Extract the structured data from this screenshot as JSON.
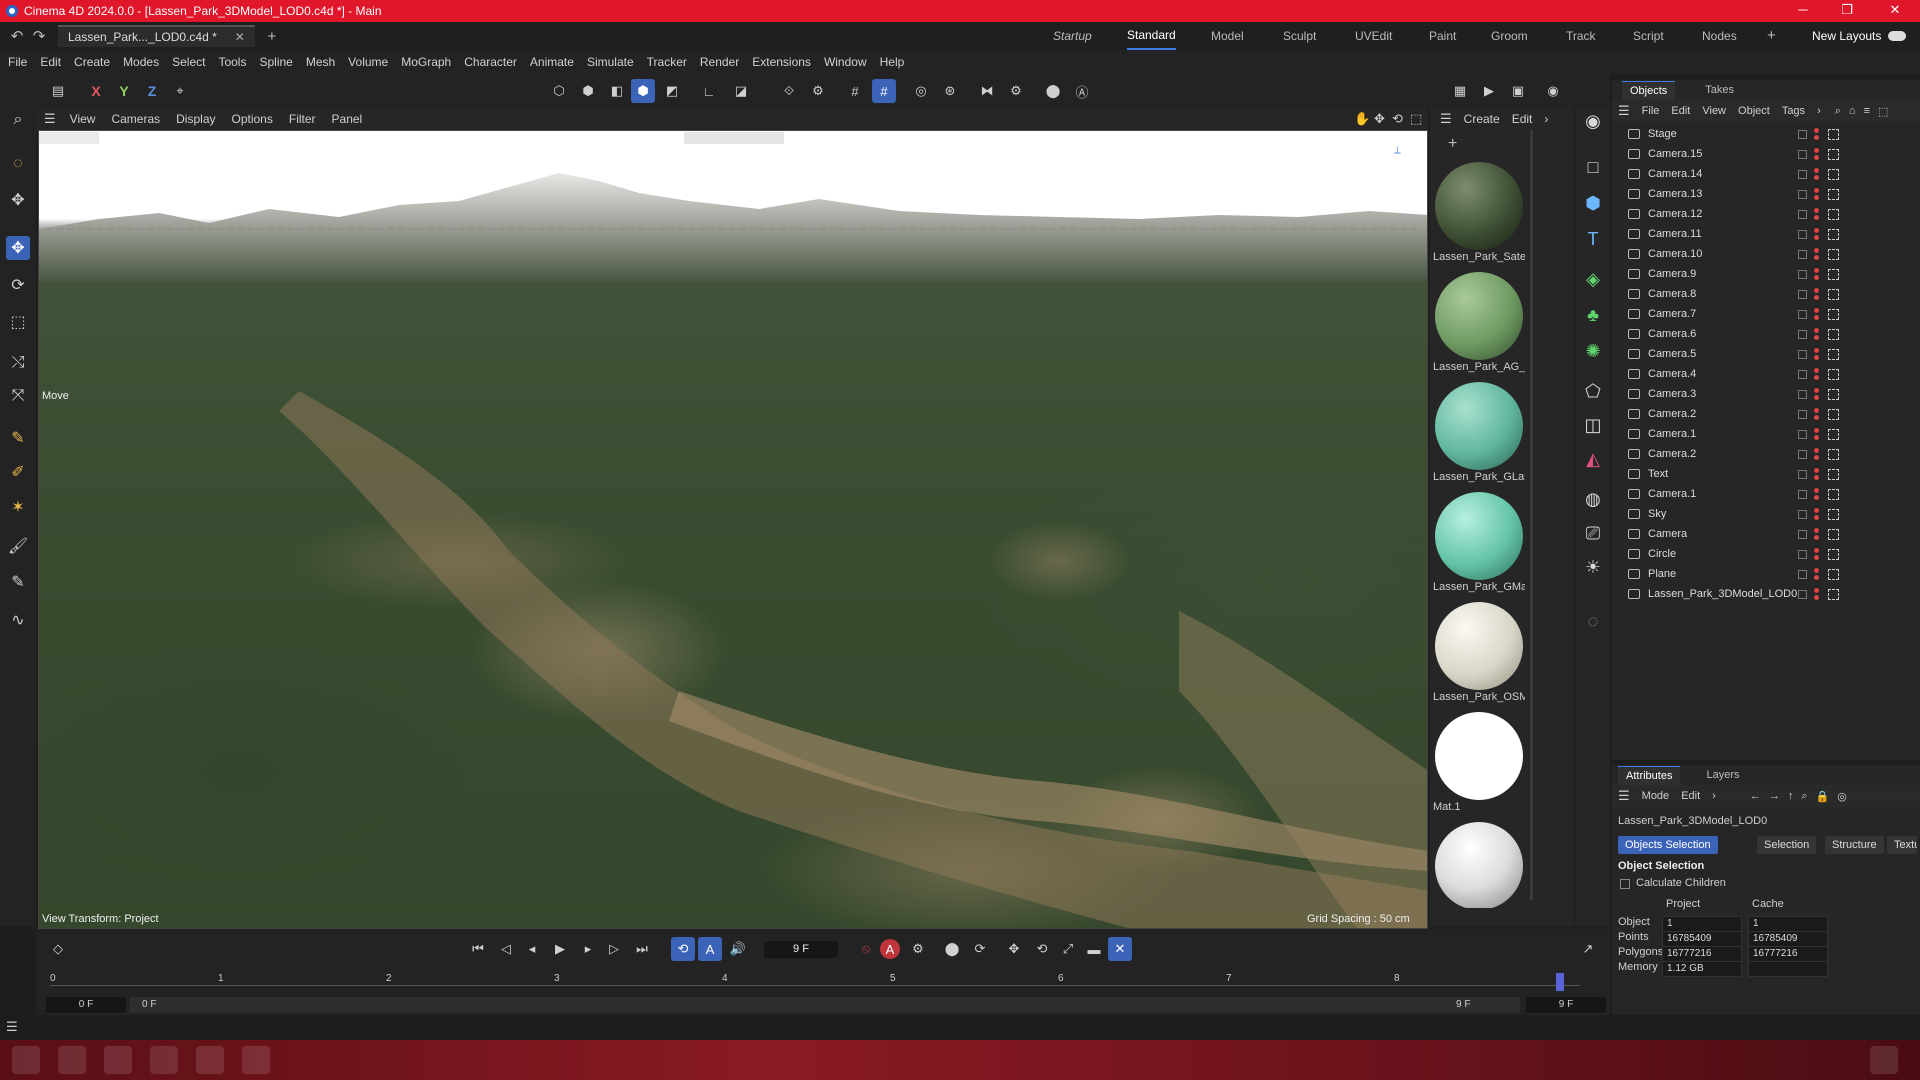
{
  "app_title": "Cinema 4D 2024.0.0 - [Lassen_Park_3DModel_LOD0.c4d *] - Main",
  "doc_tab": "Lassen_Park..._LOD0.c4d *",
  "layouts": [
    "Startup",
    "Standard",
    "Model",
    "Sculpt",
    "UVEdit",
    "Paint",
    "Groom",
    "Track",
    "Script",
    "Nodes"
  ],
  "active_layout": "Standard",
  "new_layouts": "New Layouts",
  "menubar": [
    "File",
    "Edit",
    "Create",
    "Modes",
    "Select",
    "Tools",
    "Spline",
    "Mesh",
    "Volume",
    "MoGraph",
    "Character",
    "Animate",
    "Simulate",
    "Tracker",
    "Render",
    "Extensions",
    "Window",
    "Help"
  ],
  "axis": {
    "x": "X",
    "y": "Y",
    "z": "Z"
  },
  "viewport": {
    "menu": [
      "View",
      "Cameras",
      "Display",
      "Options",
      "Filter",
      "Panel"
    ],
    "move_label": "Move",
    "view_transform": "View Transform: Project",
    "grid_spacing": "Grid Spacing : 50 cm"
  },
  "materials": {
    "menu": [
      "Create",
      "Edit"
    ],
    "items": [
      {
        "name": "Lassen_Park_Satel",
        "color": "#3a4a30"
      },
      {
        "name": "Lassen_Park_AG_L",
        "color": "#6f9a62"
      },
      {
        "name": "Lassen_Park_GLan",
        "color": "#5fb59d"
      },
      {
        "name": "Lassen_Park_GMa",
        "color": "#63c3a8"
      },
      {
        "name": "Lassen_Park_OSM",
        "color": "#d9d6c8"
      },
      {
        "name": "Mat.1",
        "color": "#ffffff"
      },
      {
        "name": "",
        "color": "#dcdcdc"
      }
    ]
  },
  "objects": {
    "tabs": [
      "Objects",
      "Takes"
    ],
    "menu": [
      "File",
      "Edit",
      "View",
      "Object",
      "Tags"
    ],
    "rows": [
      "Stage",
      "Camera.15",
      "Camera.14",
      "Camera.13",
      "Camera.12",
      "Camera.11",
      "Camera.10",
      "Camera.9",
      "Camera.8",
      "Camera.7",
      "Camera.6",
      "Camera.5",
      "Camera.4",
      "Camera.3",
      "Camera.2",
      "Camera.1",
      "Camera.2",
      "Text",
      "Camera.1",
      "Sky",
      "Camera",
      "Circle",
      "Plane",
      "Lassen_Park_3DModel_LOD0"
    ]
  },
  "attributes": {
    "tabs": [
      "Attributes",
      "Layers"
    ],
    "menu": [
      "Mode",
      "Edit"
    ],
    "object_name": "Lassen_Park_3DModel_LOD0",
    "buttons": [
      "Objects Selection",
      "Selection",
      "Structure",
      "Textures"
    ],
    "section": "Object Selection",
    "calc_children": "Calculate Children",
    "col_project": "Project",
    "col_cache": "Cache",
    "stats": [
      {
        "label": "Object",
        "project": "1",
        "cache": "1"
      },
      {
        "label": "Points",
        "project": "16785409",
        "cache": "16785409"
      },
      {
        "label": "Polygons",
        "project": "16777216",
        "cache": "16777216"
      },
      {
        "label": "Memory",
        "project": "1.12 GB",
        "cache": ""
      }
    ]
  },
  "timeline": {
    "current_frame": "9 F",
    "ticks": [
      "0",
      "1",
      "2",
      "3",
      "4",
      "5",
      "6",
      "7",
      "8"
    ],
    "start": "0 F",
    "start2": "0 F",
    "end": "9 F",
    "end2": "9 F"
  }
}
